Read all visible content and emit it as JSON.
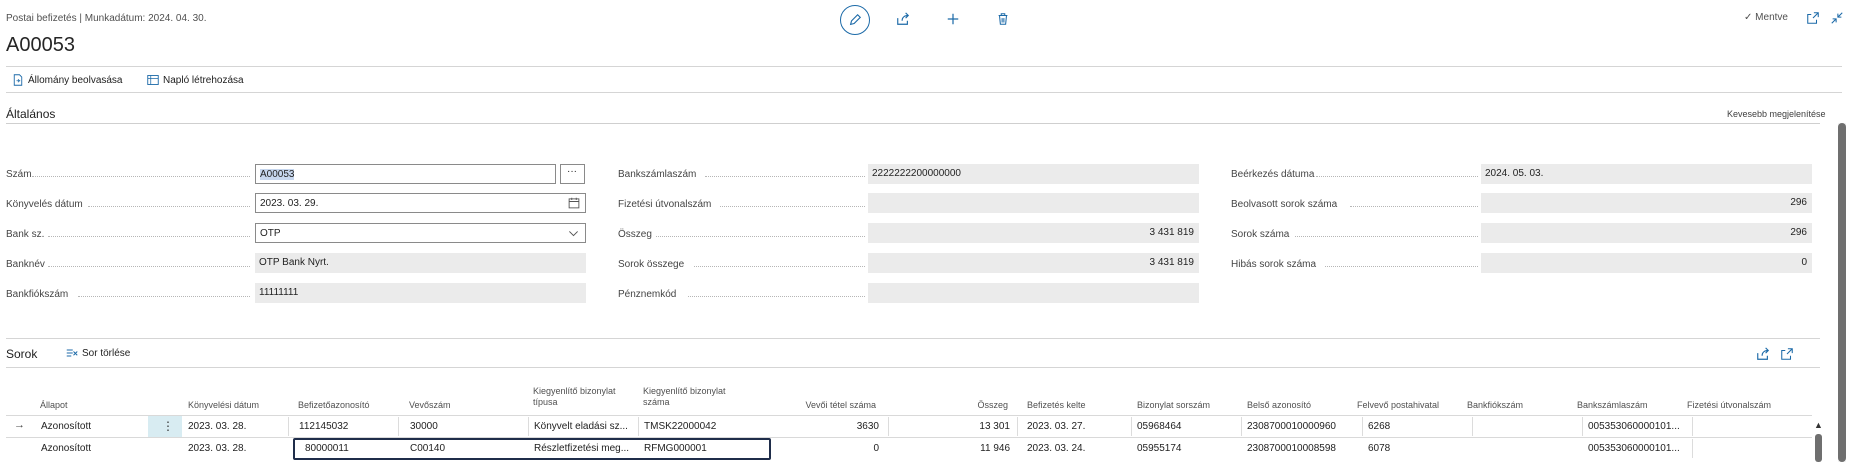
{
  "header": {
    "breadcrumb": "Postai befizetés | Munkadátum: 2024. 04. 30.",
    "title": "A00053",
    "saved_label": "Mentve"
  },
  "actions": {
    "import_label": "Állomány beolvasása",
    "journal_label": "Napló létrehozása"
  },
  "general": {
    "title": "Általános",
    "show_less": "Kevesebb megjelenítése",
    "col1": [
      {
        "label": "Szám",
        "value": "A00053"
      },
      {
        "label": "Könyvelés dátum",
        "value": "2023. 03. 29."
      },
      {
        "label": "Bank sz.",
        "value": "OTP"
      },
      {
        "label": "Banknév",
        "value": "OTP Bank Nyrt."
      },
      {
        "label": "Bankfiókszám",
        "value": "11111111"
      }
    ],
    "col2": [
      {
        "label": "Bankszámlaszám",
        "value": "2222222200000000"
      },
      {
        "label": "Fizetési útvonalszám",
        "value": ""
      },
      {
        "label": "Összeg",
        "value": "3 431 819"
      },
      {
        "label": "Sorok összege",
        "value": "3 431 819"
      },
      {
        "label": "Pénznemkód",
        "value": ""
      }
    ],
    "col3": [
      {
        "label": "Beérkezés dátuma",
        "value": "2024. 05. 03."
      },
      {
        "label": "Beolvasott sorok száma",
        "value": "296"
      },
      {
        "label": "Sorok száma",
        "value": "296"
      },
      {
        "label": "Hibás sorok száma",
        "value": "0"
      }
    ]
  },
  "lines": {
    "title": "Sorok",
    "delete_label": "Sor törlése",
    "columns": [
      "Állapot",
      "Könyvelési dátum",
      "Befizetőazonosító",
      "Vevőszám",
      "Kiegyenlítő bizonylat típusa",
      "Kiegyenlítő bizonylat száma",
      "Vevői tétel száma",
      "Összeg",
      "Befizetés kelte",
      "Bizonylat sorszám",
      "Belső azonosító",
      "Felvevő postahivatal",
      "Bankfiókszám",
      "Bankszámlaszám",
      "Fizetési útvonalszám"
    ],
    "rows": [
      {
        "status": "Azonosított",
        "posting_date": "2023. 03. 28.",
        "payer_id": "112145032",
        "customer_no": "30000",
        "doc_type": "Könyvelt eladási sz...",
        "doc_no": "TMSK22000042",
        "entry_no": "3630",
        "amount": "13 301",
        "pay_date": "2023. 03. 27.",
        "doc_seq": "05968464",
        "internal_id": "2308700010000960",
        "post_office": "6268",
        "bank_branch": "",
        "bank_account": "005353060000101...",
        "routing": ""
      },
      {
        "status": "Azonosított",
        "posting_date": "2023. 03. 28.",
        "payer_id": "80000011",
        "customer_no": "C00140",
        "doc_type": "Részletfizetési meg...",
        "doc_no": "RFMG000001",
        "entry_no": "0",
        "amount": "11 946",
        "pay_date": "2023. 03. 24.",
        "doc_seq": "05955174",
        "internal_id": "2308700010008598",
        "post_office": "6078",
        "bank_branch": "",
        "bank_account": "005353060000101...",
        "routing": ""
      }
    ]
  },
  "colors": {
    "accent": "#1c6aa8",
    "selection_outline": "#1f2d4a",
    "readonly_field": "#ebebeb"
  }
}
